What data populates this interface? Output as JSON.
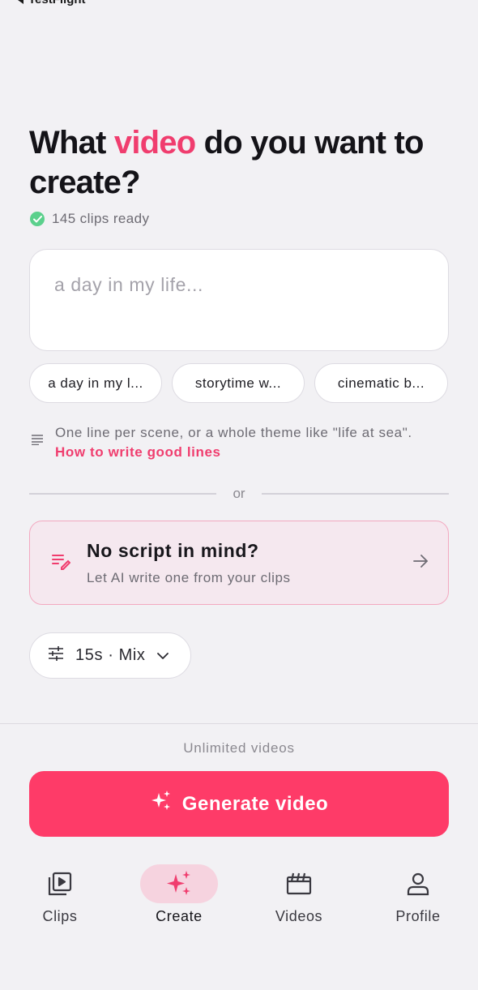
{
  "status_bar": {
    "back_label": "TestFlight"
  },
  "headline": {
    "before": "What ",
    "accent": "video",
    "after": " do you want to create?"
  },
  "clips_ready": "145 clips ready",
  "prompt": {
    "placeholder": "a day in my life..."
  },
  "suggestions": [
    {
      "label": "a day in my l..."
    },
    {
      "label": "storytime w..."
    },
    {
      "label": "cinematic b..."
    }
  ],
  "hint": {
    "text": "One line per scene, or a whole theme like \"life at sea\". ",
    "link": "How to write good lines"
  },
  "divider_label": "or",
  "no_script": {
    "title": "No script in mind?",
    "subtitle": "Let AI write one from your clips"
  },
  "settings": {
    "label": "15s · Mix"
  },
  "plan_note": "Unlimited videos",
  "generate_label": "Generate video",
  "tabs": [
    {
      "label": "Clips",
      "icon": "play-clips-icon",
      "active": false
    },
    {
      "label": "Create",
      "icon": "sparkles-icon",
      "active": true
    },
    {
      "label": "Videos",
      "icon": "clapperboard-icon",
      "active": false
    },
    {
      "label": "Profile",
      "icon": "person-icon",
      "active": false
    }
  ],
  "colors": {
    "accent": "#f03d6e",
    "button": "#fe3b68",
    "success": "#5bd08c"
  }
}
